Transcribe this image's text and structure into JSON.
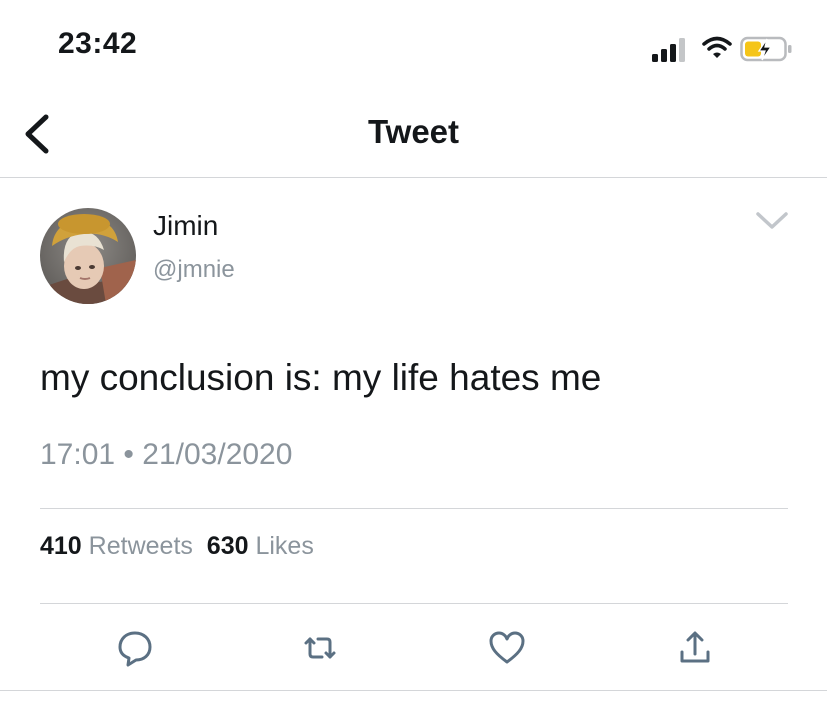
{
  "status_bar": {
    "time": "23:42",
    "icons": [
      "cellular-signal-icon",
      "wifi-icon",
      "battery-charging-icon"
    ],
    "battery_color": "#f5c518"
  },
  "nav": {
    "title": "Tweet",
    "back_icon": "chevron-left-icon"
  },
  "tweet": {
    "author_name": "Jimin",
    "author_handle": "@jmnie",
    "text": "my conclusion is: my life hates me",
    "time": "17:01",
    "separator": "•",
    "date": "21/03/2020",
    "retweets_count": "410",
    "retweets_label": "Retweets",
    "likes_count": "630",
    "likes_label": "Likes"
  },
  "actions": [
    "reply-icon",
    "retweet-icon",
    "like-icon",
    "share-icon"
  ],
  "colors": {
    "text_primary": "#14171a",
    "text_secondary": "#8b949c",
    "divider": "#d4d6d9",
    "icon": "#5b7083"
  }
}
